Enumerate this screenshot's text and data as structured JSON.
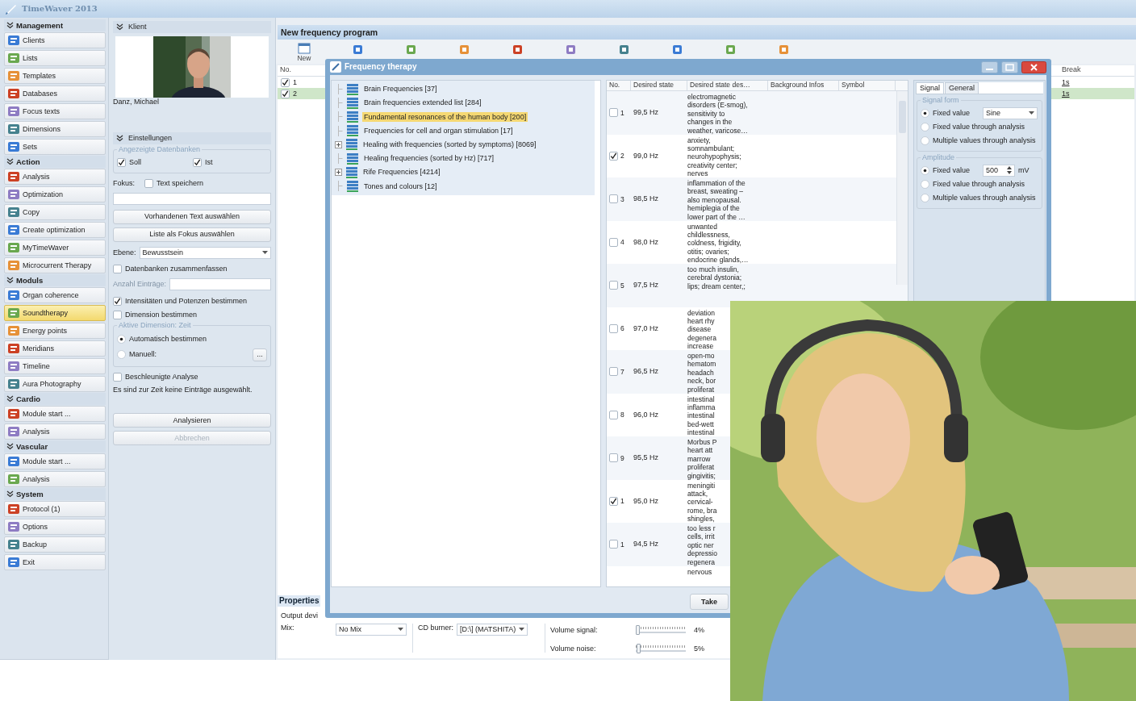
{
  "app_title": "TimeWaver 2013",
  "sidebar": {
    "sections": [
      {
        "title": "Management",
        "items": [
          {
            "label": "Clients",
            "selected": false
          },
          {
            "label": "Lists",
            "selected": false
          },
          {
            "label": "Templates",
            "selected": false
          },
          {
            "label": "Databases",
            "selected": false
          },
          {
            "label": "Focus texts",
            "selected": false
          },
          {
            "label": "Dimensions",
            "selected": false
          },
          {
            "label": "Sets",
            "selected": false
          }
        ]
      },
      {
        "title": "Action",
        "items": [
          {
            "label": "Analysis",
            "selected": false
          },
          {
            "label": "Optimization",
            "selected": false
          },
          {
            "label": "Copy",
            "selected": false
          },
          {
            "label": "Create optimization",
            "selected": false
          },
          {
            "label": "MyTimeWaver",
            "selected": false
          },
          {
            "label": "Microcurrent Therapy",
            "selected": false
          }
        ]
      },
      {
        "title": "Moduls",
        "items": [
          {
            "label": "Organ coherence",
            "selected": false
          },
          {
            "label": "Soundtherapy",
            "selected": true
          },
          {
            "label": "Energy points",
            "selected": false
          },
          {
            "label": "Meridians",
            "selected": false
          },
          {
            "label": "Timeline",
            "selected": false
          },
          {
            "label": "Aura Photography",
            "selected": false
          }
        ]
      },
      {
        "title": "Cardio",
        "items": [
          {
            "label": "Module start ...",
            "selected": false
          },
          {
            "label": "Analysis",
            "selected": false
          }
        ]
      },
      {
        "title": "Vascular",
        "items": [
          {
            "label": "Module start ...",
            "selected": false
          },
          {
            "label": "Analysis",
            "selected": false
          }
        ]
      },
      {
        "title": "System",
        "items": [
          {
            "label": "Protocol (1)",
            "selected": false
          },
          {
            "label": "Options",
            "selected": false
          },
          {
            "label": "Backup",
            "selected": false
          },
          {
            "label": "Exit",
            "selected": false
          }
        ]
      }
    ]
  },
  "client": {
    "header": "Klient",
    "name": "Danz, Michael"
  },
  "settings": {
    "header": "Einstellungen",
    "databases_group": "Angezeigte Datenbanken",
    "soll": {
      "label": "Soll",
      "checked": true
    },
    "ist": {
      "label": "Ist",
      "checked": true
    },
    "focus_label": "Fokus:",
    "save_text": {
      "label": "Text speichern",
      "checked": false
    },
    "buttons": [
      "Vorhandenen Text auswählen",
      "Liste als Fokus auswählen"
    ],
    "level_label": "Ebene:",
    "level_value": "Bewusstsein",
    "merge": {
      "label": "Datenbanken zusammenfassen",
      "checked": false
    },
    "count_label": "Anzahl Einträge:",
    "intensities": {
      "label": "Intensitäten und Potenzen bestimmen",
      "checked": true
    },
    "dimension": {
      "label": "Dimension bestimmen",
      "checked": false
    },
    "dimension_group": "Aktive Dimension: Zeit",
    "radios": [
      {
        "label": "Automatisch bestimmen",
        "selected": true
      },
      {
        "label": "Manuell:",
        "selected": false
      }
    ],
    "more_button": "...",
    "fast": {
      "label": "Beschleunigte Analyse",
      "checked": false
    },
    "info": "Es sind zur Zeit keine Einträge ausgewählt.",
    "actions": [
      {
        "label": "Analysieren",
        "disabled": false
      },
      {
        "label": "Abbrechen",
        "disabled": true
      }
    ]
  },
  "program": {
    "title": "New frequency program",
    "new_label": "New",
    "column": "No.",
    "break_header": "Break",
    "rows": [
      {
        "no": "1",
        "checked": true,
        "selected": false,
        "break": "1s"
      },
      {
        "no": "2",
        "checked": true,
        "selected": true,
        "break": "1s"
      }
    ]
  },
  "properties": {
    "header": "Properties",
    "output_label": "Output devi",
    "mix_label": "Mix:",
    "mix_value": "No Mix",
    "cd_label": "CD burner:",
    "cd_value": "[D:\\] (MATSHITA)",
    "volumes": [
      {
        "label": "Volume signal:",
        "level": 0.04,
        "reading": "4%"
      },
      {
        "label": "Volume noise:",
        "level": 0.05,
        "reading": "5%"
      }
    ]
  },
  "dialog": {
    "title": "Frequency therapy",
    "databases": [
      {
        "label": "Brain Frequencies [37]",
        "selected": false,
        "expandable": false
      },
      {
        "label": "Brain frequencies extended list [284]",
        "selected": false,
        "expandable": false
      },
      {
        "label": "Fundamental resonances of the human body [200]",
        "selected": true,
        "expandable": false
      },
      {
        "label": "Frequencies for cell and organ stimulation [17]",
        "selected": false,
        "expandable": false
      },
      {
        "label": "Healing with frequencies (sorted by symptoms) [8069]",
        "selected": false,
        "expandable": true
      },
      {
        "label": "Healing frequencies (sorted by Hz) [717]",
        "selected": false,
        "expandable": false
      },
      {
        "label": "Rife Frequencies [4214]",
        "selected": false,
        "expandable": true
      },
      {
        "label": "Tones and colours [12]",
        "selected": false,
        "expandable": false
      }
    ],
    "columns": [
      "No.",
      "Desired state",
      "Desired state des…",
      "Background Infos",
      "Symbol"
    ],
    "rows": [
      {
        "no": "1",
        "checked": false,
        "frequency": "99,5 Hz",
        "description": "electromagnetic\ndisorders (E-smog),\nsensitivity to\nchanges in the\nweather, varicose…"
      },
      {
        "no": "2",
        "checked": true,
        "frequency": "99,0 Hz",
        "description": "anxiety,\nsomnambulant;\nneurohypophysis;\ncreativity center;\nnerves"
      },
      {
        "no": "3",
        "checked": false,
        "frequency": "98,5 Hz",
        "description": "inflammation of the\nbreast, sweating –\nalso menopausal.\nhemiplegia of the\nlower part of the …"
      },
      {
        "no": "4",
        "checked": false,
        "frequency": "98,0 Hz",
        "description": "unwanted\nchildlessness,\ncoldness, frigidity,\notitis; ovaries;\nendocrine glands,…"
      },
      {
        "no": "5",
        "checked": false,
        "frequency": "97,5 Hz",
        "description": "too much insulin,\ncerebral dystonia;\nlips; dream center,;"
      },
      {
        "no": "6",
        "checked": false,
        "frequency": "97,0 Hz",
        "description": "deviation\nheart rhy\ndisease\ndegenera\nincrease"
      },
      {
        "no": "7",
        "checked": false,
        "frequency": "96,5 Hz",
        "description": "open-mo\nhematom\nheadach\nneck, bor\nproliferat"
      },
      {
        "no": "8",
        "checked": false,
        "frequency": "96,0 Hz",
        "description": "intestinal\ninflamma\nintestinal\nbed-wett\nintestinal"
      },
      {
        "no": "9",
        "checked": false,
        "frequency": "95,5 Hz",
        "description": "Morbus P\nheart att\nmarrow\nproliferat\ngingivitis;"
      },
      {
        "no": "1",
        "checked": true,
        "frequency": "95,0 Hz",
        "description": "meningiti\nattack,\ncervical-\nrome, bra\nshingles,"
      },
      {
        "no": "1",
        "checked": false,
        "frequency": "94,5 Hz",
        "description": "too less r\ncells, irrit\noptic ner\ndepressio\nregenera"
      },
      {
        "description": "nervous"
      }
    ],
    "tabs": [
      {
        "label": "Signal",
        "selected": true
      },
      {
        "label": "General",
        "selected": false
      }
    ],
    "signal_form": {
      "title": "Signal form",
      "value": "Sine",
      "options": [
        {
          "label": "Fixed value",
          "selected": true
        },
        {
          "label": "Fixed value through analysis",
          "selected": false
        },
        {
          "label": "Multiple values through analysis",
          "selected": false
        }
      ]
    },
    "amplitude": {
      "title": "Amplitude",
      "value": "500",
      "unit": "mV",
      "options": [
        {
          "label": "Fixed value",
          "selected": true
        },
        {
          "label": "Fixed value through analysis",
          "selected": false
        },
        {
          "label": "Multiple values through analysis",
          "selected": false
        }
      ]
    },
    "take_button": "Take"
  }
}
